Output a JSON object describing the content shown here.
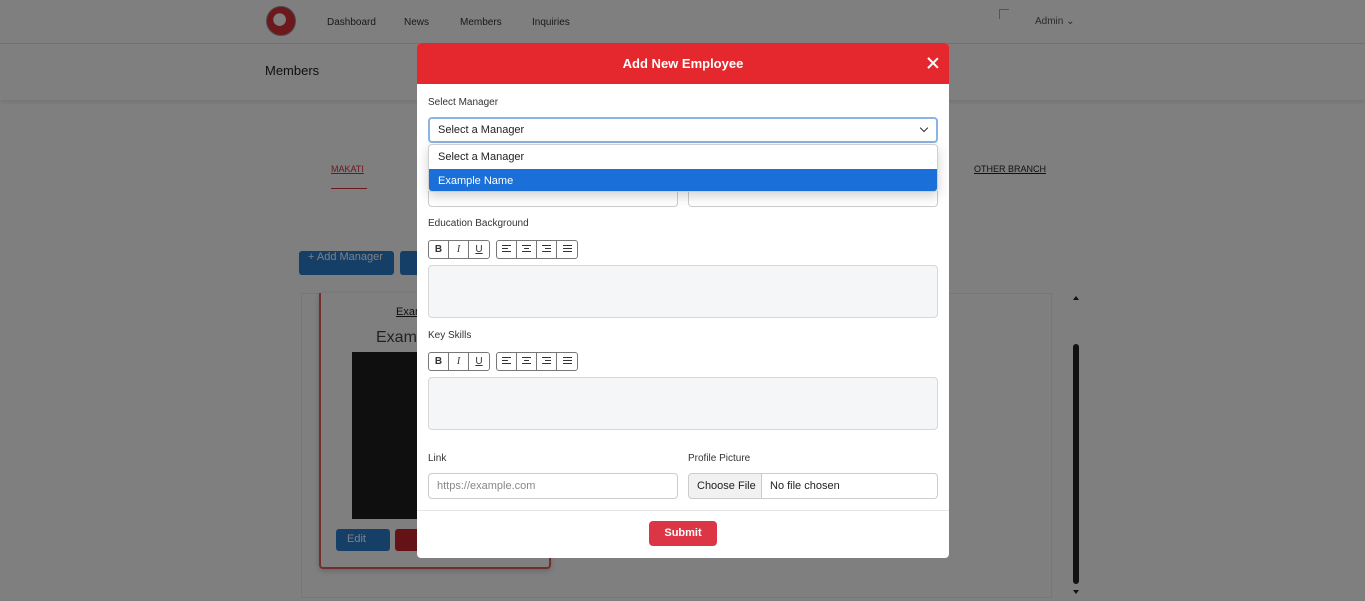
{
  "nav": {
    "links": [
      "Dashboard",
      "News",
      "Members",
      "Inquiries"
    ],
    "admin_label": "Admin ⌄"
  },
  "page": {
    "title": "Members",
    "branches": [
      "MAKATI",
      "OTHER BRANCH"
    ],
    "add_manager_label": "+ Add Manager",
    "member_card": {
      "link_text": "Exan",
      "name": "Examp",
      "edit_label": "Edit"
    }
  },
  "modal": {
    "title": "Add New Employee",
    "select_manager_label": "Select Manager",
    "select_manager_value": "Select a Manager",
    "dropdown_options": [
      {
        "label": "Select a Manager",
        "selected": false
      },
      {
        "label": "Example Name",
        "selected": true
      }
    ],
    "education_label": "Education Background",
    "key_skills_label": "Key Skills",
    "toolbar": {
      "bold": "B",
      "italic": "I",
      "underline": "U"
    },
    "link_label": "Link",
    "link_placeholder": "https://example.com",
    "profile_label": "Profile Picture",
    "choose_file_label": "Choose File",
    "no_file_text": "No file chosen",
    "submit_label": "Submit"
  },
  "colors": {
    "modal_header": "#e5282e",
    "submit": "#dc3545",
    "primary": "#2d7fd0",
    "highlight": "#1a6fd8"
  }
}
